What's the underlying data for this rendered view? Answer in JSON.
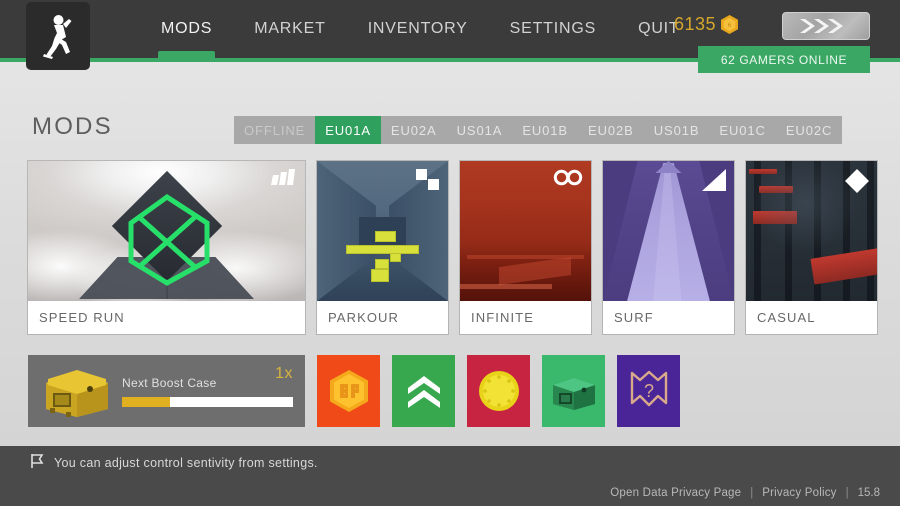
{
  "topbar": {
    "logo_icon": "running-figure-icon",
    "nav": [
      {
        "label": "MODS",
        "active": true
      },
      {
        "label": "MARKET",
        "active": false
      },
      {
        "label": "INVENTORY",
        "active": false
      },
      {
        "label": "SETTINGS",
        "active": false
      },
      {
        "label": "QUIT",
        "active": false
      }
    ],
    "currency": {
      "amount": "6135",
      "icon": "hex-coin-icon",
      "color": "#d4a72c"
    },
    "avatar": {
      "icon": "chevrons-rank-icon"
    },
    "online_badge": {
      "text": "62 GAMERS ONLINE",
      "color": "#3aa864"
    }
  },
  "header": {
    "page_title": "MODS",
    "server_tabs": [
      {
        "label": "OFFLINE",
        "active": false
      },
      {
        "label": "EU01A",
        "active": true
      },
      {
        "label": "EU02A",
        "active": false
      },
      {
        "label": "US01A",
        "active": false
      },
      {
        "label": "EU01B",
        "active": false
      },
      {
        "label": "EU02B",
        "active": false
      },
      {
        "label": "US01B",
        "active": false
      },
      {
        "label": "EU01C",
        "active": false
      },
      {
        "label": "EU02C",
        "active": false
      }
    ]
  },
  "mods": [
    {
      "label": "SPEED RUN",
      "badge_icon": "speed-bars-icon",
      "wide": true
    },
    {
      "label": "PARKOUR",
      "badge_icon": "two-squares-icon",
      "wide": false
    },
    {
      "label": "INFINITE",
      "badge_icon": "infinity-icon",
      "wide": false
    },
    {
      "label": "SURF",
      "badge_icon": "slope-icon",
      "wide": false
    },
    {
      "label": "CASUAL",
      "badge_icon": "diamond-icon",
      "wide": false
    }
  ],
  "boost": {
    "crate_icon": "yellow-crate-icon",
    "title": "Next Boost Case",
    "multiplier": "1x",
    "progress_percent": 28
  },
  "tiles": [
    {
      "icon": "bp-hex-icon",
      "bg": "#ef4a18",
      "label": "BP"
    },
    {
      "icon": "double-chevron-up-icon",
      "bg": "#38a84e",
      "label": ""
    },
    {
      "icon": "gold-coin-icon",
      "bg": "#c72442",
      "label": ""
    },
    {
      "icon": "green-crate-icon",
      "bg": "#3ab86b",
      "label": ""
    },
    {
      "icon": "mystery-shield-icon",
      "bg": "#4a2598",
      "label": "?"
    }
  ],
  "tip": {
    "icon": "flag-icon",
    "text": "You can adjust control sentivity from settings."
  },
  "footer": {
    "link_privacy_page": "Open Data Privacy Page",
    "link_privacy_policy": "Privacy Policy",
    "separator": "|",
    "version": "15.8"
  }
}
